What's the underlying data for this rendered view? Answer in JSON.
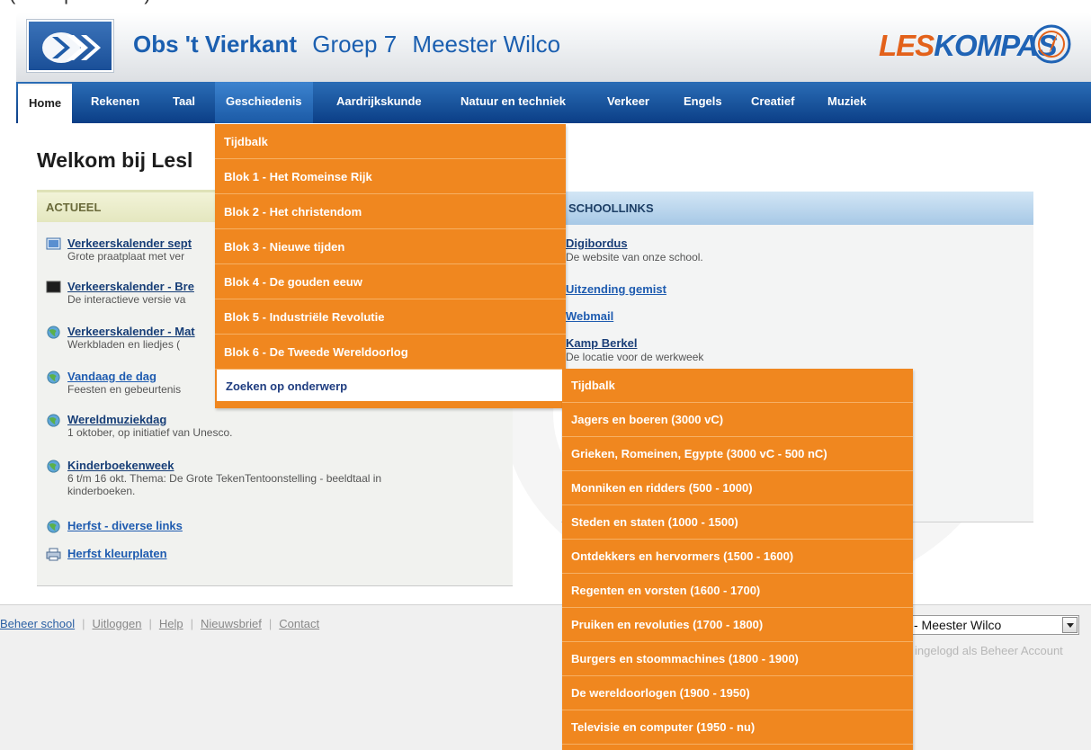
{
  "header": {
    "school": "Obs 't Vierkant",
    "group": "Groep 7",
    "teacher": "Meester Wilco",
    "brand_prefix": "LES",
    "brand_suffix": "KOMPAS"
  },
  "nav": [
    {
      "label": "Home"
    },
    {
      "label": "Rekenen"
    },
    {
      "label": "Taal"
    },
    {
      "label": "Geschiedenis"
    },
    {
      "label": "Aardrijkskunde"
    },
    {
      "label": "Natuur en techniek"
    },
    {
      "label": "Verkeer"
    },
    {
      "label": "Engels"
    },
    {
      "label": "Creatief"
    },
    {
      "label": "Muziek"
    }
  ],
  "welcome": "Welkom bij Lesl",
  "actueel": {
    "title": "ACTUEEL",
    "items": [
      {
        "link": "Verkeerskalender sept",
        "desc": "Grote praatplaat met ver",
        "icon": "monitor-icon"
      },
      {
        "link": "Verkeerskalender - Bre",
        "desc": "De interactieve versie va",
        "icon": "board-icon"
      },
      {
        "link": "Verkeerskalender - Mat",
        "desc": "Werkbladen en liedjes (",
        "icon": "globe-icon"
      },
      {
        "link": "Vandaag de dag",
        "desc": "Feesten en gebeurtenis",
        "icon": "globe-icon"
      },
      {
        "link": "Wereldmuziekdag",
        "desc": "1 oktober, op initiatief van Unesco.",
        "icon": "globe-icon"
      },
      {
        "link": "Kinderboekenweek",
        "desc": "6 t/m 16 okt. Thema: De Grote TekenTentoonstelling - beeldtaal in",
        "desc2": "kinderboeken.",
        "icon": "globe-icon"
      },
      {
        "link": "Herfst - diverse links",
        "icon": "globe-icon"
      },
      {
        "link": "Herfst kleurplaten",
        "icon": "printer-icon"
      }
    ]
  },
  "schoollinks": {
    "title": "SCHOOLLINKS",
    "items": [
      {
        "link": "Digibordus",
        "desc": "De website van onze school."
      },
      {
        "link": "Uitzending gemist"
      },
      {
        "link": "Webmail"
      },
      {
        "link": "Kamp Berkel",
        "desc": "De locatie voor de werkweek"
      }
    ]
  },
  "menu_geschiedenis": [
    "Tijdbalk",
    "Blok 1 - Het Romeinse Rijk",
    "Blok 2 - Het christendom",
    "Blok 3 - Nieuwe tijden",
    "Blok 4 - De gouden eeuw",
    "Blok 5 - Industriële Revolutie",
    "Blok 6 - De Tweede Wereldoorlog",
    "Zoeken op onderwerp"
  ],
  "menu_tijdbalk": [
    "Tijdbalk",
    "Jagers en boeren (3000 vC)",
    "Grieken, Romeinen, Egypte (3000 vC - 500 nC)",
    "Monniken en ridders (500 - 1000)",
    "Steden en staten (1000 - 1500)",
    "Ontdekkers en hervormers (1500 - 1600)",
    "Regenten en vorsten (1600 - 1700)",
    "Pruiken en revoluties (1700 - 1800)",
    "Burgers en stoommachines (1800 - 1900)",
    "De wereldoorlogen (1900 - 1950)",
    "Televisie en computer (1950 - nu)"
  ],
  "footer": {
    "links": [
      "Beheer school",
      "Uitloggen",
      "Help",
      "Nieuwsbrief",
      "Contact"
    ],
    "select_value": "- Meester Wilco",
    "login_text": "ingelogd als Beheer Account"
  },
  "colors": {
    "menu_orange": "#f0871f",
    "nav_blue": "#0b3e86",
    "title_blue": "#1b5fb0"
  }
}
